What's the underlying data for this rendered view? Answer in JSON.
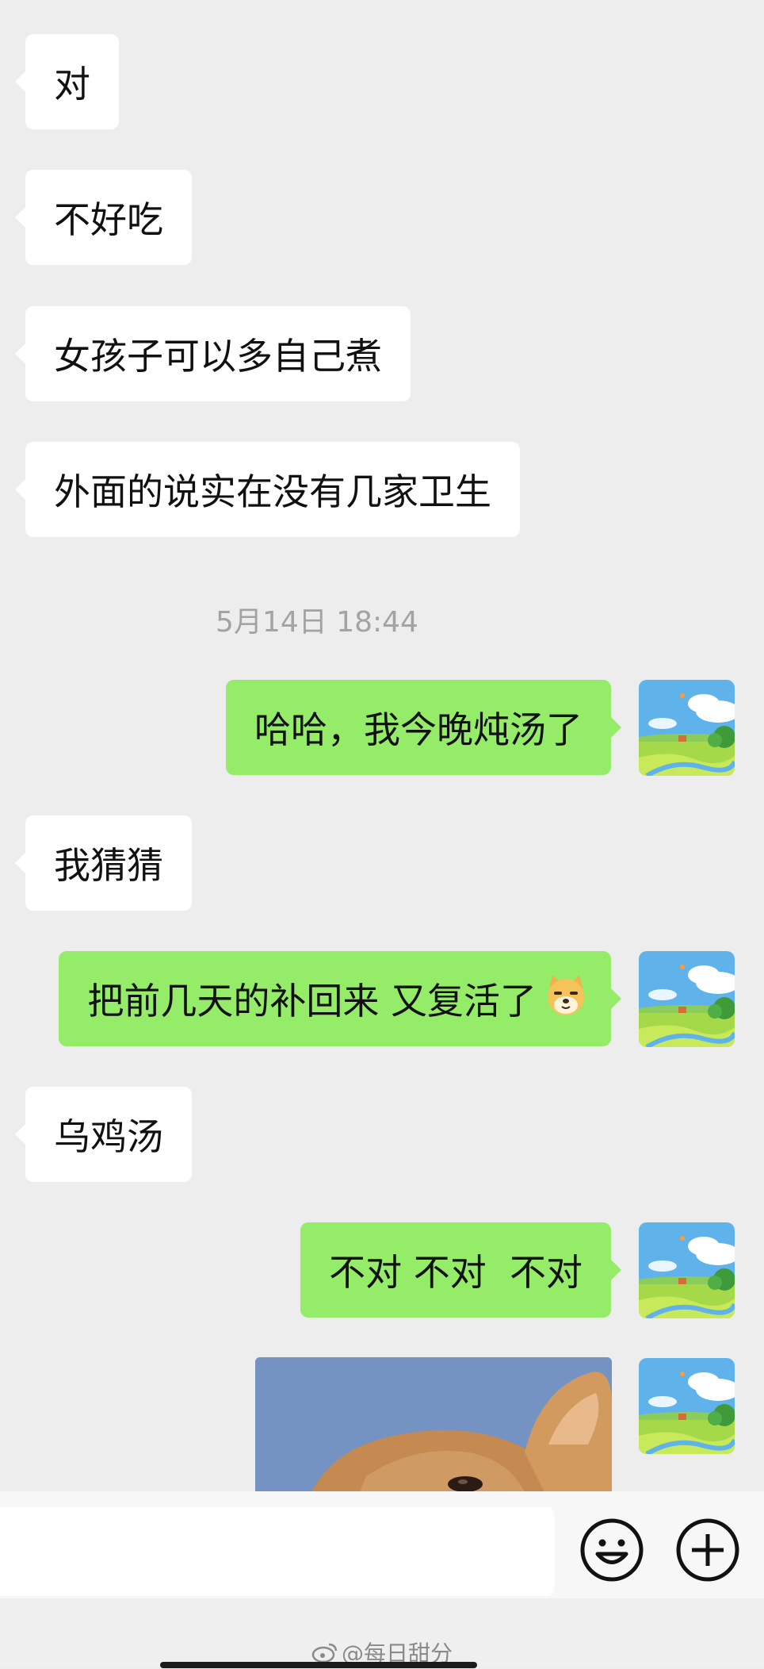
{
  "messages": [
    {
      "side": "in",
      "text": "对"
    },
    {
      "side": "in",
      "text": "不好吃"
    },
    {
      "side": "in",
      "text": "女孩子可以多自己煮"
    },
    {
      "side": "in",
      "text": "外面的说实在没有几家卫生"
    },
    {
      "side": "out",
      "text": "哈哈，我今晚炖汤了"
    },
    {
      "side": "in",
      "text": "我猜猜"
    },
    {
      "side": "out",
      "text": "把前几天的补回来 又复活了",
      "emoji": "doge-emoji"
    },
    {
      "side": "in",
      "text": "乌鸡汤"
    },
    {
      "side": "out",
      "text": "不对 不对  不对"
    },
    {
      "side": "out",
      "type": "image",
      "content": "dog-photo"
    }
  ],
  "timestamp": "5月14日 18:44",
  "input_bar": {
    "placeholder": "",
    "emoji_icon": "smiley-face-icon",
    "more_icon": "plus-circle-icon"
  },
  "watermark": {
    "text": "@每日甜分",
    "logo": "weibo-logo"
  },
  "colors": {
    "background": "#ededed",
    "incoming_bubble": "#ffffff",
    "outgoing_bubble": "#95ec69",
    "timestamp_text": "#a3a3a3"
  }
}
